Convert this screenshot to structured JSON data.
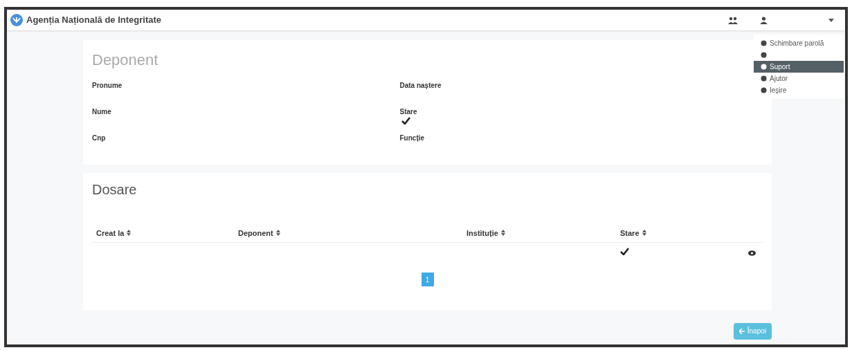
{
  "navbar": {
    "brand": "Agenția Națională de Integritate"
  },
  "user_menu": {
    "expanded": true,
    "items": [
      {
        "kind": "item",
        "label": "Schimbare parolă",
        "selected": false
      },
      {
        "kind": "item",
        "selected": false
      },
      {
        "kind": "item",
        "label": "Suport",
        "selected": true
      },
      {
        "kind": "item",
        "label": "Ajutor",
        "selected": false
      },
      {
        "kind": "item",
        "label": "Ieșire",
        "selected": false
      }
    ]
  },
  "deponent": {
    "title": "Deponent",
    "fields": [
      {
        "kind": "text",
        "label": "Pronume"
      },
      {
        "kind": "text",
        "label": "Data naștere"
      },
      {
        "kind": "text",
        "label": "Nume"
      },
      {
        "kind": "check",
        "label": "Stare",
        "checked": true
      },
      {
        "kind": "text",
        "label": "Cnp"
      },
      {
        "kind": "text",
        "label": "Funcție"
      }
    ]
  },
  "dosare": {
    "title": "Dosare",
    "table": {
      "columns": [
        "Creat la",
        "Deponent",
        "Instituție",
        "Stare"
      ],
      "rows": [
        {
          "checked": true
        }
      ]
    },
    "pagination": [
      {
        "label": "1",
        "selected": true
      }
    ]
  },
  "back_button": "Înapoi"
}
